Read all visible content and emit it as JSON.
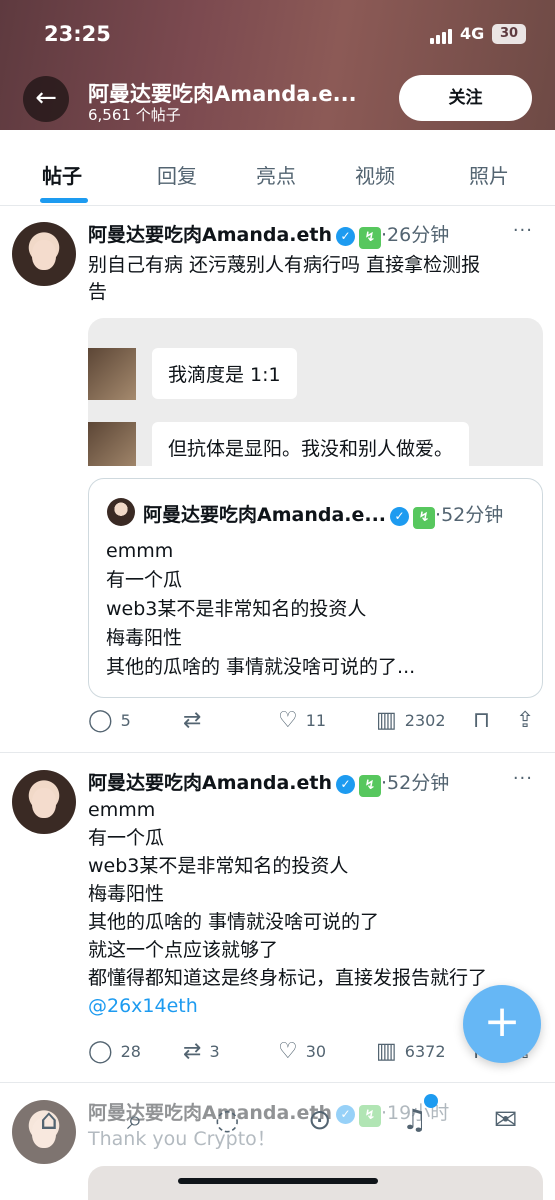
{
  "status_bar": {
    "time": "23:25",
    "network": "4G",
    "battery": "30"
  },
  "header": {
    "title": "阿曼达要吃肉Amanda.e...",
    "subtitle": "6,561 个帖子",
    "follow_label": "关注"
  },
  "tabs": [
    {
      "label": "帖子"
    },
    {
      "label": "回复"
    },
    {
      "label": "亮点"
    },
    {
      "label": "视频"
    },
    {
      "label": "照片"
    }
  ],
  "posts": [
    {
      "name": "阿曼达要吃肉Amanda.eth",
      "time": "·26分钟",
      "text_lines": [
        "别自己有病 还污蔑别人有病行吗 直接拿检测报",
        "告"
      ],
      "screenshot": {
        "bubbles": [
          "我滴度是 1:1",
          "但抗体是显阳。我没和别人做爱。"
        ]
      },
      "quote": {
        "name": "阿曼达要吃肉Amanda.e...",
        "time": "·52分钟",
        "lines": [
          "emmm",
          "有一个瓜",
          "web3某不是非常知名的投资人",
          "梅毒阳性",
          "其他的瓜啥的 事情就没啥可说的了..."
        ]
      },
      "stats": {
        "replies": "5",
        "retweets": "",
        "likes": "11",
        "views": "2302"
      }
    },
    {
      "name": "阿曼达要吃肉Amanda.eth",
      "time": "·52分钟",
      "text_lines": [
        "emmm",
        "有一个瓜",
        "web3某不是非常知名的投资人",
        "梅毒阳性",
        "其他的瓜啥的 事情就没啥可说的了",
        "就这一个点应该就够了",
        "都懂得都知道这是终身标记，直接发报告就行了"
      ],
      "mention": "@26x14eth",
      "stats": {
        "replies": "28",
        "retweets": "3",
        "likes": "30",
        "views": "6372"
      }
    },
    {
      "name": "阿曼达要吃肉Amanda.eth",
      "time": "·19小时",
      "text_lines": [
        "Thank you Crypto！"
      ]
    }
  ],
  "fab_label": "+",
  "icons": {
    "back": "back-arrow-icon",
    "more": "more-icon",
    "reply": "reply-icon",
    "retweet": "retweet-icon",
    "like": "heart-icon",
    "views": "views-icon",
    "bookmark": "bookmark-icon",
    "share": "share-icon"
  },
  "colors": {
    "accent": "#1d9bf0",
    "verified": "#1d9bf0",
    "badge": "#57c75e"
  }
}
